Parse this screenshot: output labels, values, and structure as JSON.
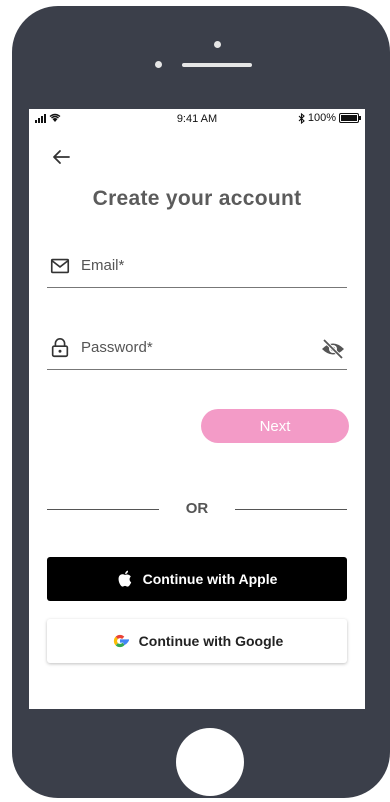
{
  "status_bar": {
    "time": "9:41 AM",
    "battery_text": "100%"
  },
  "page": {
    "title": "Create your account"
  },
  "form": {
    "email_label": "Email*",
    "password_label": "Password*"
  },
  "actions": {
    "next_label": "Next",
    "or_label": "OR"
  },
  "social": {
    "apple_label": "Continue with Apple",
    "google_label": "Continue with Google"
  },
  "colors": {
    "phone_body": "#3b3f4a",
    "next_button": "#f39bc7",
    "apple_button": "#000000"
  }
}
